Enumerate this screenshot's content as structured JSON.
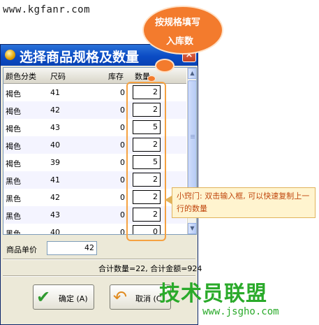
{
  "watermark": {
    "site_text": "www.kgfanr.com",
    "brand_logo_text": "技术员联盟",
    "brand_url": "www.jsgho.com"
  },
  "window": {
    "title": "选择商品规格及数量",
    "close_label": "×",
    "columns": [
      "颜色分类",
      "尺码",
      "库存",
      "数量"
    ],
    "rows": [
      {
        "color": "褐色",
        "size": "41",
        "stock": "0",
        "qty": "2"
      },
      {
        "color": "褐色",
        "size": "42",
        "stock": "0",
        "qty": "2"
      },
      {
        "color": "褐色",
        "size": "43",
        "stock": "0",
        "qty": "5"
      },
      {
        "color": "褐色",
        "size": "40",
        "stock": "0",
        "qty": "2"
      },
      {
        "color": "褐色",
        "size": "39",
        "stock": "0",
        "qty": "5"
      },
      {
        "color": "黑色",
        "size": "41",
        "stock": "0",
        "qty": "2"
      },
      {
        "color": "黑色",
        "size": "42",
        "stock": "0",
        "qty": "2"
      },
      {
        "color": "黑色",
        "size": "43",
        "stock": "0",
        "qty": "2"
      },
      {
        "color": "黑色",
        "size": "40",
        "stock": "0",
        "qty": "0"
      }
    ],
    "price_label": "商品单价",
    "price_value": "42",
    "summary": "合计数量=22, 合计金额=924",
    "ok_button": "确定 (A)",
    "cancel_button": "取消 (C)"
  },
  "annotations": {
    "callout_line1": "按规格填写",
    "callout_line2": "入库数",
    "tip": "小窍门: 双击输入框, 可以快速复制上一行的数量",
    "accent_color": "#f37b2d"
  }
}
